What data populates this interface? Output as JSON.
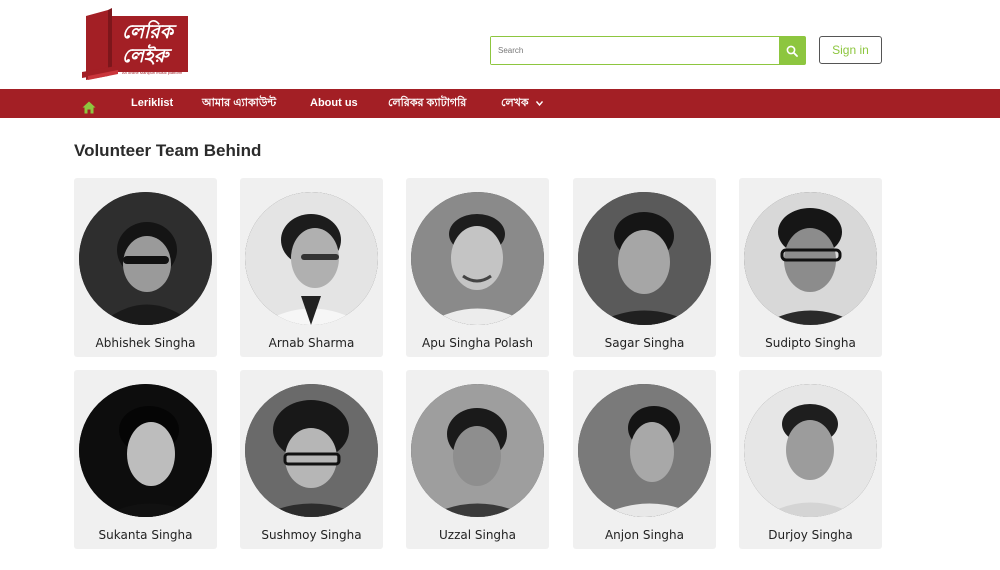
{
  "logo": {
    "text_line1": "লেরিক",
    "text_line2": "লেইরু",
    "tagline": "An online Manipuri music platform"
  },
  "search": {
    "placeholder": "Search"
  },
  "auth": {
    "signin_label": "Sign in"
  },
  "nav": {
    "items": [
      {
        "label": "Leriklist"
      },
      {
        "label": "আমার এ্যাকাউন্ট"
      },
      {
        "label": "About us"
      },
      {
        "label": "লেরিকর ক্যাটাগরি"
      },
      {
        "label": "লেখক"
      }
    ]
  },
  "page": {
    "title": "Volunteer Team Behind"
  },
  "team": [
    {
      "name": "Abhishek Singha"
    },
    {
      "name": "Arnab Sharma"
    },
    {
      "name": "Apu Singha Polash"
    },
    {
      "name": "Sagar Singha"
    },
    {
      "name": "Sudipto Singha"
    },
    {
      "name": "Sukanta Singha"
    },
    {
      "name": "Sushmoy Singha"
    },
    {
      "name": "Uzzal Singha"
    },
    {
      "name": "Anjon Singha"
    },
    {
      "name": "Durjoy Singha"
    }
  ],
  "colors": {
    "brand_red": "#a31f25",
    "accent_green": "#8dc63f",
    "card_bg": "#f0f0f0"
  },
  "icons": {
    "home": "home-icon",
    "search": "search-icon",
    "caret": "chevron-down-icon"
  }
}
